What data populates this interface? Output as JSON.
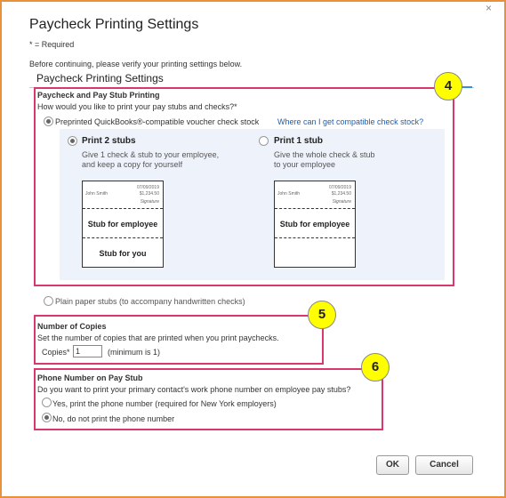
{
  "dialog": {
    "title": "Paycheck Printing Settings",
    "required_note": "* = Required",
    "intro": "Before continuing, please verify your printing settings below.",
    "section_heading": "Paycheck Printing Settings"
  },
  "pay_stub_printing": {
    "heading": "Paycheck and Pay Stub Printing",
    "question": "How would you like to print your pay stubs and checks?*",
    "preprinted_label": "Preprinted QuickBooks®-compatible voucher check stock",
    "preprinted_link": "Where can I get compatible check stock?",
    "option_2_title": "Print 2 stubs",
    "option_2_desc_line1": "Give 1 check & stub to your employee,",
    "option_2_desc_line2": "and keep a copy for yourself",
    "option_1_title": "Print 1 stub",
    "option_1_desc_line1": "Give the whole check & stub",
    "option_1_desc_line2": "to your employee",
    "preview_date": "07/09/2019",
    "preview_name": "John Smith",
    "preview_amount": "$1,234.50",
    "preview_signature": "Signature",
    "stub_employee_label": "Stub for employee",
    "stub_you_label": "Stub for you",
    "plain_paper_label": "Plain paper stubs (to accompany handwritten checks)"
  },
  "copies": {
    "heading": "Number of Copies",
    "desc": "Set the number of copies that are printed when you print paychecks.",
    "label": "Copies*",
    "value": "1",
    "hint": "(minimum is 1)"
  },
  "phone": {
    "heading": "Phone Number on Pay Stub",
    "question": "Do you want to print your primary contact's work phone number on employee pay stubs?",
    "yes_label": "Yes, print the phone number (required for New York employers)",
    "no_label": "No, do not print the phone number"
  },
  "badges": {
    "b4": "4",
    "b5": "5",
    "b6": "6"
  },
  "buttons": {
    "ok": "OK",
    "cancel": "Cancel",
    "close": "×"
  },
  "colors": {
    "frame": "#e8913a",
    "highlight": "#d9386f",
    "badge": "#ffff00",
    "link": "#1a5fb4"
  }
}
